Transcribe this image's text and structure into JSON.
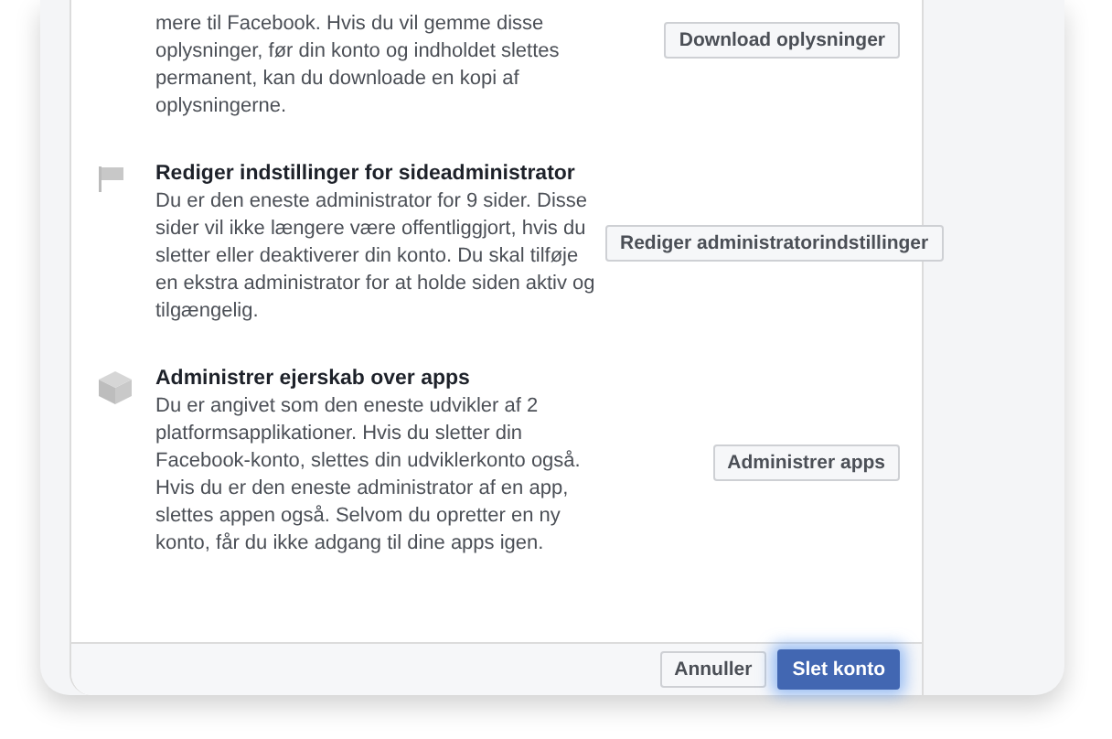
{
  "sections": [
    {
      "lines": [
        "mere til Facebook. Hvis du vil gemme disse oplysninger, før din konto og indholdet slettes permanent, kan du downloade en kopi af oplysningerne."
      ],
      "button": "Download oplysninger"
    },
    {
      "kind": "flag",
      "title": "Rediger indstillinger for sideadministrator",
      "lines": [
        "Du er den eneste administrator for 9 sider. Disse sider vil ikke længere være offentliggjort, hvis du sletter eller deaktiverer din konto. Du skal tilføje en ekstra administrator for at holde siden aktiv og tilgængelig."
      ],
      "button": "Rediger administratorindstillinger"
    },
    {
      "kind": "cube",
      "title": "Administrer ejerskab over apps",
      "lines": [
        "Du er angivet som den eneste udvikler af 2 platformsapplikationer. Hvis du sletter din Facebook-konto, slettes din udviklerkonto også. Hvis du er den eneste administrator af en app, slettes appen også. Selvom du opretter en ny konto, får du ikke adgang til dine apps igen."
      ],
      "button": "Administrer apps"
    }
  ],
  "footer": {
    "cancel": "Annuller",
    "confirm": "Slet konto"
  }
}
